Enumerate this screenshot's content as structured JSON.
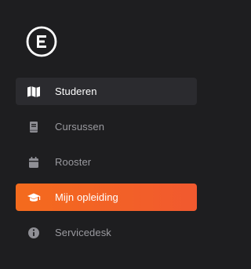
{
  "app": {
    "logo_icon": "brand-e-logo-icon"
  },
  "sidebar": {
    "items": [
      {
        "label": "Studeren",
        "icon": "map-icon",
        "state": "active"
      },
      {
        "label": "Cursussen",
        "icon": "book-icon",
        "state": "default"
      },
      {
        "label": "Rooster",
        "icon": "calendar-icon",
        "state": "default"
      },
      {
        "label": "Mijn opleiding",
        "icon": "graduation-cap-icon",
        "state": "highlight"
      },
      {
        "label": "Servicedesk",
        "icon": "info-icon",
        "state": "default"
      }
    ]
  },
  "colors": {
    "background": "#1e1e20",
    "active_background": "#2b2b2f",
    "highlight_start": "#f46b1d",
    "highlight_end": "#f1592f",
    "muted_text": "#9a9a9f",
    "active_text": "#ffffff"
  }
}
